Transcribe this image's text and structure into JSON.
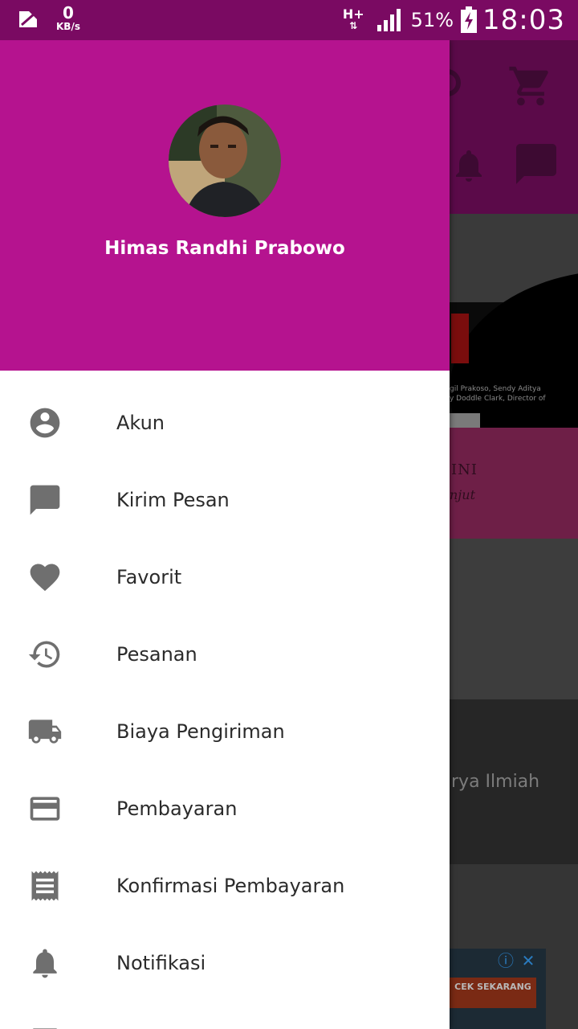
{
  "status_bar": {
    "net_speed_value": "0",
    "net_speed_unit": "KB/s",
    "network_type": "H+",
    "battery": "51%",
    "time": "18:03"
  },
  "colors": {
    "drawer_header": "#b5138f",
    "status_bar": "#7a0a62",
    "icon_gray": "#6f6f6f"
  },
  "drawer": {
    "user_name": "Himas Randhi Prabowo",
    "menu": [
      {
        "label": "Akun",
        "icon": "account-circle-icon"
      },
      {
        "label": "Kirim Pesan",
        "icon": "message-icon"
      },
      {
        "label": "Favorit",
        "icon": "heart-icon"
      },
      {
        "label": "Pesanan",
        "icon": "history-icon"
      },
      {
        "label": "Biaya Pengiriman",
        "icon": "truck-icon"
      },
      {
        "label": "Pembayaran",
        "icon": "credit-card-icon"
      },
      {
        "label": "Konfirmasi Pembayaran",
        "icon": "receipt-icon"
      },
      {
        "label": "Notifikasi",
        "icon": "bell-icon"
      }
    ]
  },
  "background": {
    "photo_caption_line1": "gil Prakoso, Sendy Aditya",
    "photo_caption_line2": "y Doddle Clark, Director of",
    "pink_title": "INI",
    "pink_subtitle": "njut",
    "section_title": "rya Ilmiah",
    "ad_button": "CEK SEKARANG"
  }
}
